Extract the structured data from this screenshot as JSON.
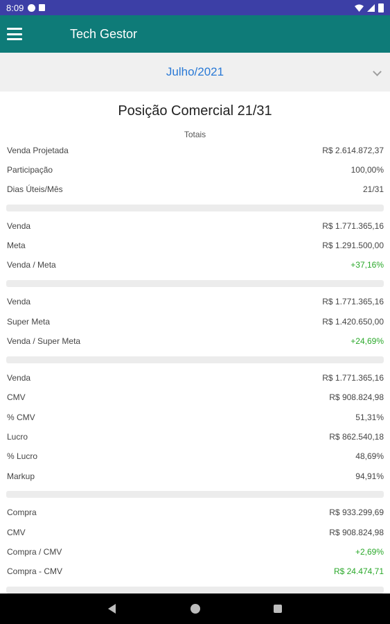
{
  "status_bar": {
    "time": "8:09",
    "icons": [
      "data-saver-icon",
      "sd-card-icon",
      "wifi-icon",
      "signal-icon",
      "battery-icon"
    ]
  },
  "app_bar": {
    "title": "Tech Gestor",
    "menu_icon": "hamburger-menu-icon",
    "background": "#0e7b78"
  },
  "month_selector": {
    "value": "Julho/2021",
    "color": "#2979d6"
  },
  "report": {
    "title": "Posição Comercial 21/31",
    "subtitle": "Totais",
    "sections": [
      {
        "rows": [
          {
            "label": "Venda Projetada",
            "value": "R$ 2.614.872,37"
          },
          {
            "label": "Participação",
            "value": "100,00%"
          },
          {
            "label": "Dias Úteis/Mês",
            "value": "21/31"
          }
        ]
      },
      {
        "rows": [
          {
            "label": "Venda",
            "value": "R$ 1.771.365,16"
          },
          {
            "label": "Meta",
            "value": "R$ 1.291.500,00"
          },
          {
            "label": "Venda / Meta",
            "value": "+37,16%"
          }
        ]
      },
      {
        "rows": [
          {
            "label": "Venda",
            "value": "R$ 1.771.365,16"
          },
          {
            "label": "Super Meta",
            "value": "R$ 1.420.650,00"
          },
          {
            "label": "Venda / Super Meta",
            "value": "+24,69%"
          }
        ]
      },
      {
        "rows": [
          {
            "label": "Venda",
            "value": "R$ 1.771.365,16"
          },
          {
            "label": "CMV",
            "value": "R$ 908.824,98"
          },
          {
            "label": "% CMV",
            "value": "51,31%"
          },
          {
            "label": "Lucro",
            "value": "R$ 862.540,18"
          },
          {
            "label": "% Lucro",
            "value": "48,69%"
          },
          {
            "label": "Markup",
            "value": "94,91%"
          }
        ]
      },
      {
        "rows": [
          {
            "label": "Compra",
            "value": "R$ 933.299,69"
          },
          {
            "label": "CMV",
            "value": "R$ 908.824,98"
          },
          {
            "label": "Compra / CMV",
            "value": "+2,69%"
          },
          {
            "label": "Compra - CMV",
            "value": "R$ 24.474,71"
          }
        ]
      }
    ],
    "positive_color": "#29a829"
  },
  "nav_bar": {
    "icons": [
      "back-icon",
      "home-icon",
      "recent-apps-icon"
    ]
  }
}
